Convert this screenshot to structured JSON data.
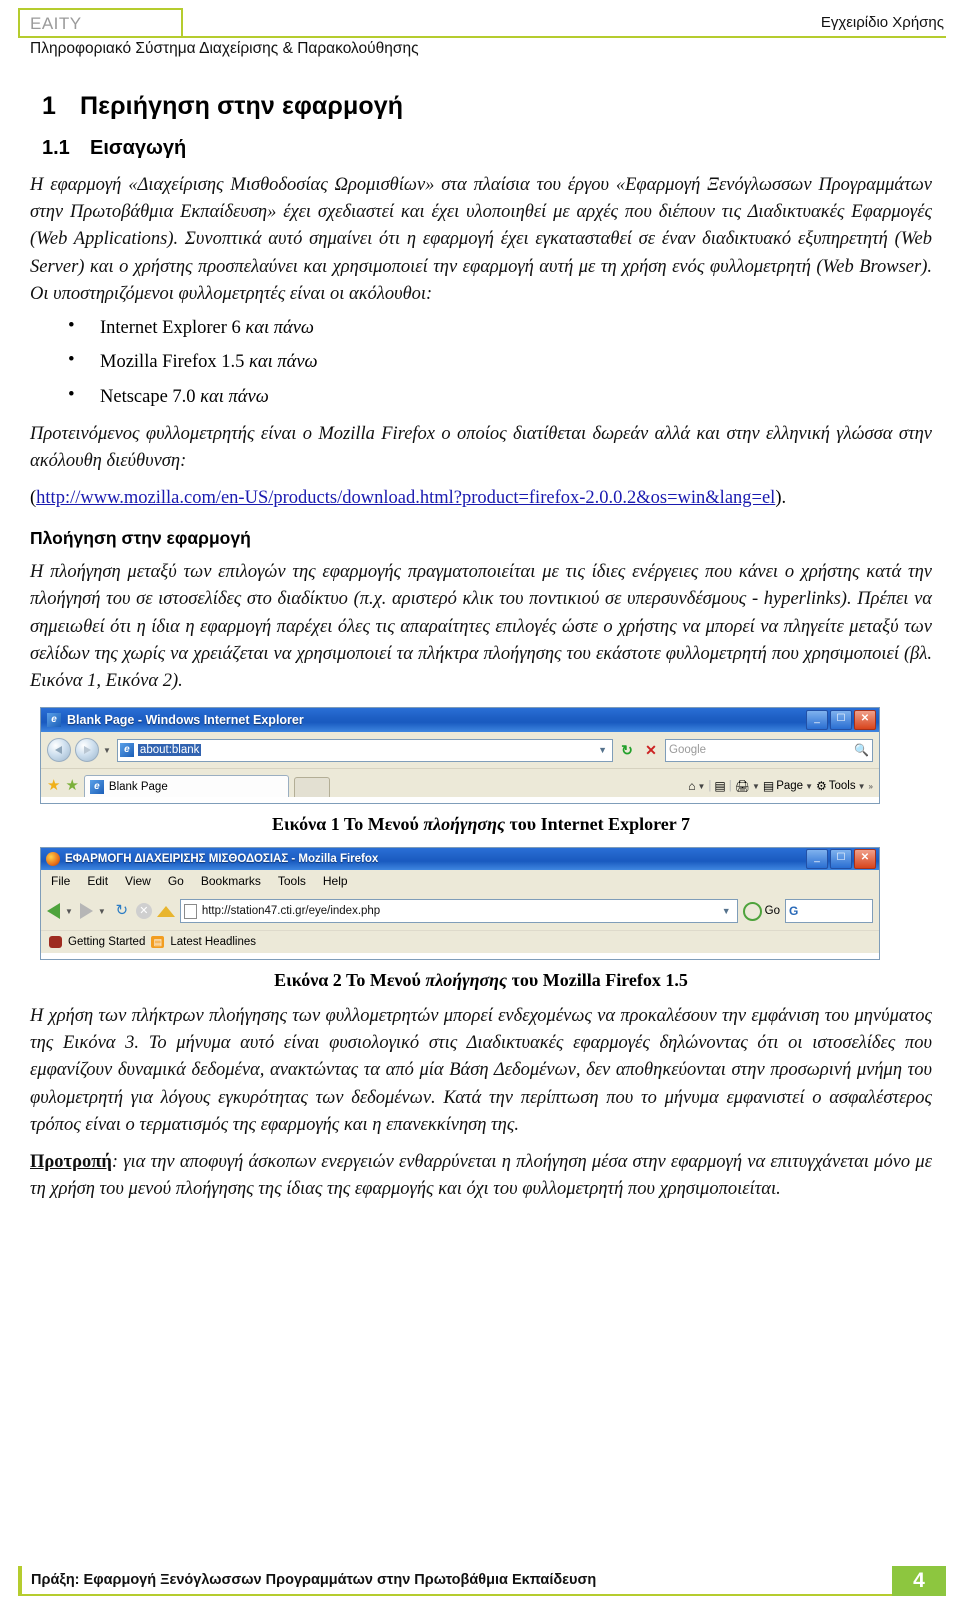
{
  "header": {
    "logo": "EAITY",
    "right_label": "Εγχειρίδιο Χρήσης",
    "subtitle": "Πληροφοριακό Σύστημα Διαχείρισης & Παρακολούθησης"
  },
  "section": {
    "number": "1",
    "title": "Περιήγηση στην εφαρμογή",
    "sub_number": "1.1",
    "sub_title": "Εισαγωγή"
  },
  "paragraphs": {
    "p1": "Η εφαρμογή «Διαχείρισης Μισθοδοσίας Ωρομισθίων» στα πλαίσια του έργου «Εφαρμογή Ξενόγλωσσων Προγραμμάτων στην Πρωτοβάθμια Εκπαίδευση» έχει σχεδιαστεί και έχει υλοποιηθεί με αρχές που διέπουν τις Διαδικτυακές Εφαρμογές (Web Applications). Συνοπτικά αυτό σημαίνει ότι η εφαρμογή έχει εγκατασταθεί σε έναν διαδικτυακό εξυπηρετητή (Web Server) και ο χρήστης προσπελαύνει και χρησιμοποιεί την εφαρμογή αυτή με τη χρήση ενός φυλλομετρητή (Web Browser). Οι υποστηριζόμενοι φυλλομετρητές είναι οι ακόλουθοι:",
    "p2_before_link": "Προτεινόμενος φυλλομετρητής είναι ο Mozilla Firefox ο οποίος διατίθεται δωρεάν αλλά και στην ελληνική γλώσσα στην ακόλουθη διεύθυνση:",
    "p3": "Η πλοήγηση μεταξύ των επιλογών της εφαρμογής πραγματοποιείται με τις ίδιες ενέργειες που κάνει ο χρήστης κατά την πλοήγησή του σε ιστοσελίδες στο διαδίκτυο (π.χ. αριστερό κλικ του ποντικιού σε υπερσυνδέσμους - hyperlinks). Πρέπει να σημειωθεί ότι η ίδια η εφαρμογή παρέχει όλες τις απαραίτητες επιλογές ώστε ο χρήστης να μπορεί να πληγείτε μεταξύ των σελίδων της χωρίς να χρειάζεται να χρησιμοποιεί τα πλήκτρα πλοήγησης του εκάστοτε φυλλομετρητή που χρησιμοποιεί (βλ. Εικόνα 1, Εικόνα 2).",
    "p4": "Η χρήση των πλήκτρων πλοήγησης των φυλλομετρητών μπορεί ενδεχομένως να προκαλέσουν την εμφάνιση του μηνύματος της Εικόνα 3. Το μήνυμα αυτό είναι φυσιολογικό στις Διαδικτυακές εφαρμογές δηλώνοντας ότι οι ιστοσελίδες που εμφανίζουν δυναμικά δεδομένα, ανακτώντας τα από μία Βάση Δεδομένων, δεν αποθηκεύονται στην προσωρινή μνήμη του φυλομετρητή για λόγους εγκυρότητας των δεδομένων. Κατά την περίπτωση που το μήνυμα εμφανιστεί ο ασφαλέστερος τρόπος είναι ο τερματισμός της εφαρμογής και η επανεκκίνηση της.",
    "p5_label": "Προτροπή",
    "p5_rest": ": για την αποφυγή άσκοπων ενεργειών ενθαρρύνεται η πλοήγηση μέσα στην εφαρμογή να επιτυγχάνεται μόνο με τη χρήση του μενού πλοήγησης της ίδιας της εφαρμογής και όχι του φυλλομετρητή που χρησιμοποιείται."
  },
  "browsers_list": [
    {
      "name": "Internet Explorer 6",
      "suffix": "και πάνω"
    },
    {
      "name": "Mozilla Firefox 1.5",
      "suffix": "και πάνω"
    },
    {
      "name": "Netscape 7.0",
      "suffix": "και πάνω"
    }
  ],
  "download_link": {
    "open_paren": "(",
    "url_line1": "http://www.mozilla.com/en-US/products/download.html?product=firefox-",
    "url_line2": "2.0.0.2&os=win&lang=el",
    "close": ")."
  },
  "nav_heading": "Πλοήγηση στην εφαρμογή",
  "figure1": {
    "caption_prefix": "Εικόνα 1 Το Μενού ",
    "caption_italic": "πλοήγησης",
    "caption_suffix": " του Internet Explorer 7",
    "window_title": "Blank Page - Windows Internet Explorer",
    "address_value": "about:blank",
    "search_placeholder": "Google",
    "tab_label": "Blank Page",
    "toolbar_buttons": [
      "Page",
      "Tools"
    ],
    "minimize": "_",
    "maximize": "☐",
    "close": "✕",
    "overflow": "»"
  },
  "figure2": {
    "caption_prefix": "Εικόνα 2 Το Μενού ",
    "caption_italic": "πλοήγησης",
    "caption_suffix": " του Mozilla Firefox 1.5",
    "window_title": "ΕΦΑΡΜΟΓΗ ΔΙΑΧΕΙΡΙΣΗΣ ΜΙΣΘΟΔΟΣΙΑΣ - Mozilla Firefox",
    "menu_items": [
      "File",
      "Edit",
      "View",
      "Go",
      "Bookmarks",
      "Tools",
      "Help"
    ],
    "address_value": "http://station47.cti.gr/eye/index.php",
    "go_label": "Go",
    "bookmarks": [
      "Getting Started",
      "Latest Headlines"
    ],
    "minimize": "_",
    "maximize": "☐",
    "close": "✕"
  },
  "footer": {
    "text": "Πράξη: Εφαρμογή Ξενόγλωσσων Προγραμμάτων στην Πρωτοβάθμια Εκπαίδευση",
    "page_number": "4"
  },
  "colors": {
    "accent_green": "#b5cc2e",
    "footer_green": "#8dc63f",
    "link_blue": "#1a1ab0"
  }
}
